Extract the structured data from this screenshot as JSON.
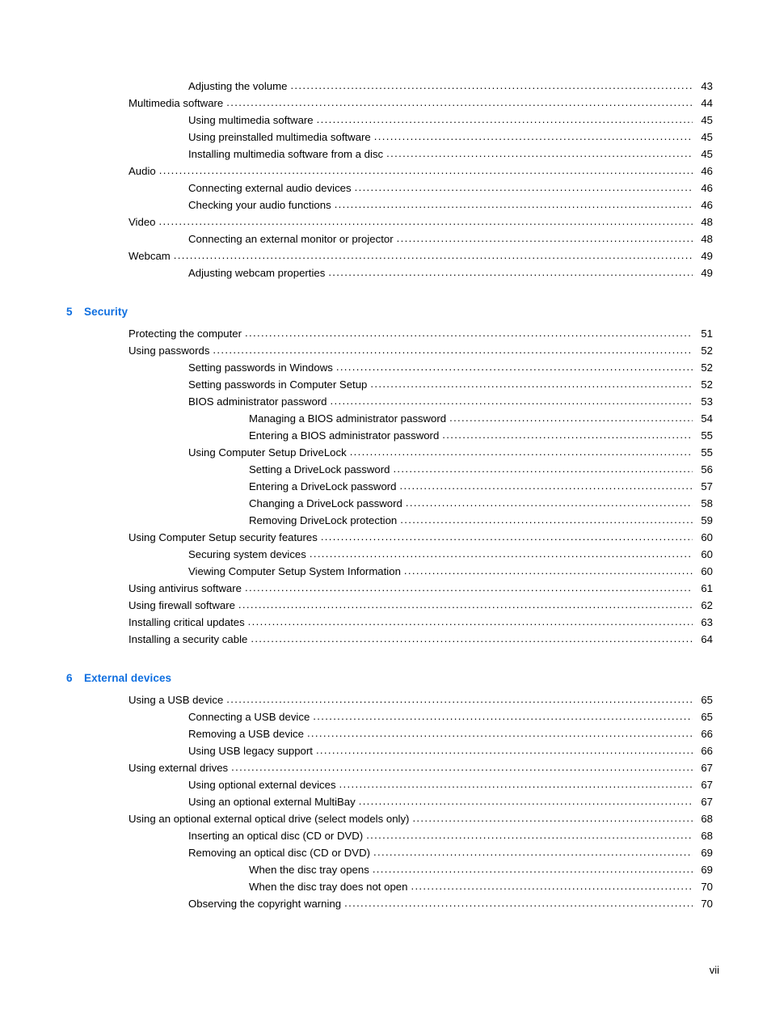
{
  "document": {
    "footer_page_label": "vii"
  },
  "toc": {
    "leader_dots": "...................................................................................................................................................................",
    "blocks": [
      {
        "type": "entries",
        "entries": [
          {
            "level": 2,
            "label": "Adjusting the volume",
            "page": "43"
          },
          {
            "level": 1,
            "label": "Multimedia software",
            "page": "44"
          },
          {
            "level": 2,
            "label": "Using multimedia software",
            "page": "45"
          },
          {
            "level": 2,
            "label": "Using preinstalled multimedia software",
            "page": "45"
          },
          {
            "level": 2,
            "label": "Installing multimedia software from a disc",
            "page": "45"
          },
          {
            "level": 1,
            "label": "Audio",
            "page": "46"
          },
          {
            "level": 2,
            "label": "Connecting external audio devices",
            "page": "46"
          },
          {
            "level": 2,
            "label": "Checking your audio functions",
            "page": "46"
          },
          {
            "level": 1,
            "label": "Video",
            "page": "48"
          },
          {
            "level": 2,
            "label": "Connecting an external monitor or projector",
            "page": "48"
          },
          {
            "level": 1,
            "label": "Webcam",
            "page": "49"
          },
          {
            "level": 2,
            "label": "Adjusting webcam properties",
            "page": "49"
          }
        ]
      },
      {
        "type": "chapter",
        "number": "5",
        "title": "Security",
        "entries": [
          {
            "level": 1,
            "label": "Protecting the computer",
            "page": "51"
          },
          {
            "level": 1,
            "label": "Using passwords",
            "page": "52"
          },
          {
            "level": 2,
            "label": "Setting passwords in Windows",
            "page": "52"
          },
          {
            "level": 2,
            "label": "Setting passwords in Computer Setup",
            "page": "52"
          },
          {
            "level": 2,
            "label": "BIOS administrator password",
            "page": "53"
          },
          {
            "level": 3,
            "label": "Managing a BIOS administrator password",
            "page": "54"
          },
          {
            "level": 3,
            "label": "Entering a BIOS administrator password",
            "page": "55"
          },
          {
            "level": 2,
            "label": "Using Computer Setup DriveLock",
            "page": "55"
          },
          {
            "level": 3,
            "label": "Setting a DriveLock password",
            "page": "56"
          },
          {
            "level": 3,
            "label": "Entering a DriveLock password",
            "page": "57"
          },
          {
            "level": 3,
            "label": "Changing a DriveLock password",
            "page": "58"
          },
          {
            "level": 3,
            "label": "Removing DriveLock protection",
            "page": "59"
          },
          {
            "level": 1,
            "label": "Using Computer Setup security features",
            "page": "60"
          },
          {
            "level": 2,
            "label": "Securing system devices",
            "page": "60"
          },
          {
            "level": 2,
            "label": "Viewing Computer Setup System Information",
            "page": "60"
          },
          {
            "level": 1,
            "label": "Using antivirus software",
            "page": "61"
          },
          {
            "level": 1,
            "label": "Using firewall software",
            "page": "62"
          },
          {
            "level": 1,
            "label": "Installing critical updates",
            "page": "63"
          },
          {
            "level": 1,
            "label": "Installing a security cable",
            "page": "64"
          }
        ]
      },
      {
        "type": "chapter",
        "number": "6",
        "title": "External devices",
        "entries": [
          {
            "level": 1,
            "label": "Using a USB device",
            "page": "65"
          },
          {
            "level": 2,
            "label": "Connecting a USB device",
            "page": "65"
          },
          {
            "level": 2,
            "label": "Removing a USB device",
            "page": "66"
          },
          {
            "level": 2,
            "label": "Using USB legacy support",
            "page": "66"
          },
          {
            "level": 1,
            "label": "Using external drives",
            "page": "67"
          },
          {
            "level": 2,
            "label": "Using optional external devices",
            "page": "67"
          },
          {
            "level": 2,
            "label": "Using an optional external MultiBay",
            "page": "67"
          },
          {
            "level": 1,
            "label": "Using an optional external optical drive (select models only)",
            "page": "68"
          },
          {
            "level": 2,
            "label": "Inserting an optical disc (CD or DVD)",
            "page": "68"
          },
          {
            "level": 2,
            "label": "Removing an optical disc (CD or DVD)",
            "page": "69"
          },
          {
            "level": 3,
            "label": "When the disc tray opens",
            "page": "69"
          },
          {
            "level": 3,
            "label": "When the disc tray does not open",
            "page": "70"
          },
          {
            "level": 2,
            "label": "Observing the copyright warning",
            "page": "70"
          }
        ]
      }
    ]
  }
}
